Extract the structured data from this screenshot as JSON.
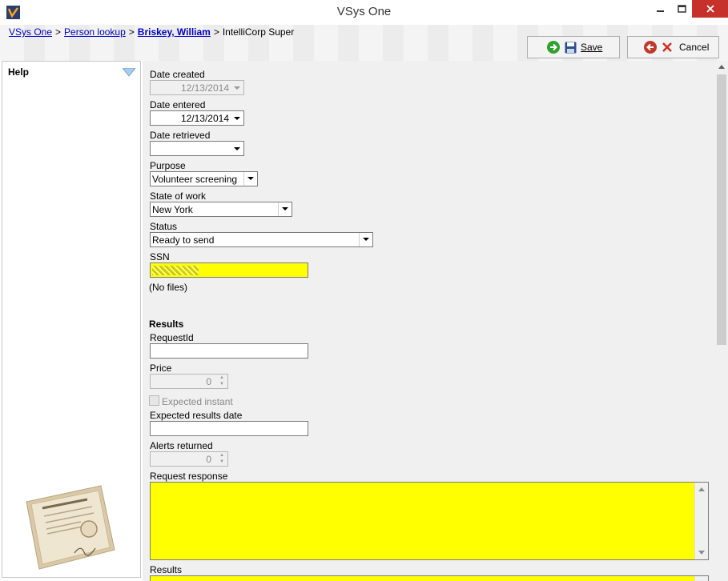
{
  "window": {
    "title": "VSys One"
  },
  "breadcrumb": {
    "items": [
      "VSys One",
      "Person lookup",
      "Briskey, William"
    ],
    "separator": ">",
    "current": "IntelliCorp Super"
  },
  "toolbar": {
    "save_label": "Save",
    "cancel_label": "Cancel"
  },
  "help": {
    "title": "Help"
  },
  "form": {
    "date_created": {
      "label": "Date created",
      "value": "12/13/2014"
    },
    "date_entered": {
      "label": "Date entered",
      "value": "12/13/2014"
    },
    "date_retrieved": {
      "label": "Date retrieved",
      "value": ""
    },
    "purpose": {
      "label": "Purpose",
      "value": "Volunteer screening"
    },
    "state_of_work": {
      "label": "State of work",
      "value": "New York"
    },
    "status": {
      "label": "Status",
      "value": "Ready to send"
    },
    "ssn": {
      "label": "SSN"
    },
    "files_text": "(No files)",
    "results_section": "Results",
    "request_id": {
      "label": "RequestId",
      "value": ""
    },
    "price": {
      "label": "Price",
      "value": "0"
    },
    "expected_instant": {
      "label": "Expected instant"
    },
    "expected_results_date": {
      "label": "Expected results date",
      "value": ""
    },
    "alerts_returned": {
      "label": "Alerts returned",
      "value": "0"
    },
    "request_response": {
      "label": "Request response"
    },
    "results": {
      "label": "Results"
    }
  },
  "colors": {
    "highlight": "#ffff00",
    "close_button": "#c7312b",
    "link": "#0000cc"
  }
}
